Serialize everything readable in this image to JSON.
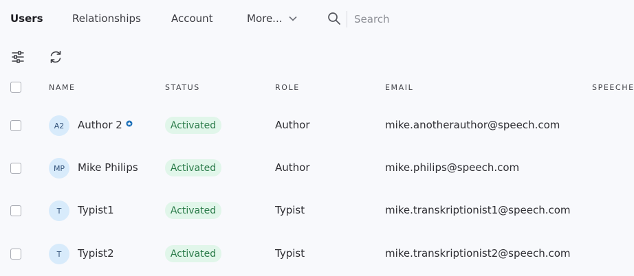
{
  "nav": {
    "tabs": [
      "Users",
      "Relationships",
      "Account",
      "More..."
    ],
    "active_tab": "Users",
    "search_placeholder": "Search"
  },
  "toolbar": {
    "filter_icon": "sliders-icon",
    "refresh_icon": "refresh-icon"
  },
  "table": {
    "headers": {
      "name": "NAME",
      "status": "STATUS",
      "role": "ROLE",
      "email": "EMAIL",
      "speeches": "SPEECHE"
    },
    "rows": [
      {
        "initials": "A2",
        "name": "Author 2",
        "verified": true,
        "status": "Activated",
        "role": "Author",
        "email": "mike.anotherauthor@speech.com"
      },
      {
        "initials": "MP",
        "name": "Mike Philips",
        "verified": false,
        "status": "Activated",
        "role": "Author",
        "email": "mike.philips@speech.com"
      },
      {
        "initials": "T",
        "name": "Typist1",
        "verified": false,
        "status": "Activated",
        "role": "Typist",
        "email": "mike.transkriptionist1@speech.com"
      },
      {
        "initials": "T",
        "name": "Typist2",
        "verified": false,
        "status": "Activated",
        "role": "Typist",
        "email": "mike.transkriptionist2@speech.com"
      }
    ]
  },
  "colors": {
    "background": "#f8f9fc",
    "avatar_bg": "#d8ebfb",
    "status_bg": "#e1f6ea",
    "status_text": "#2a7b49",
    "verified_badge": "#1b6fb8"
  }
}
